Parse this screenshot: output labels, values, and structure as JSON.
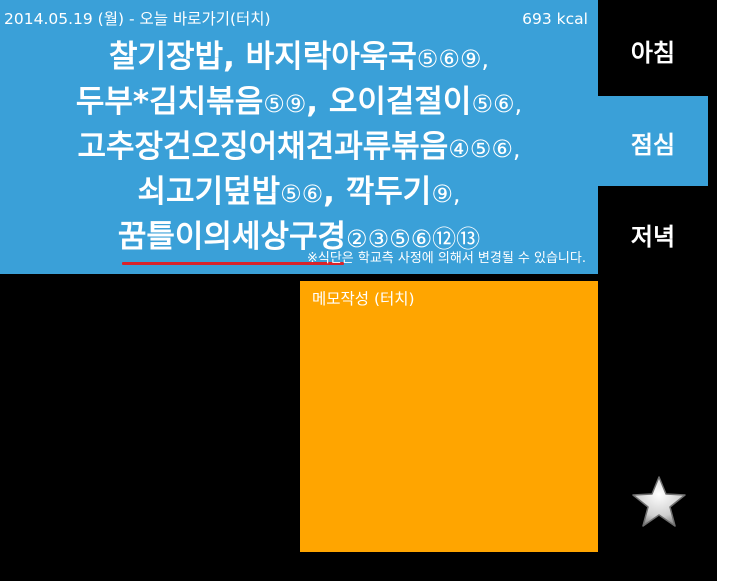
{
  "header": {
    "date_text": "2014.05.19 (월) - 오늘 바로가기(터치)",
    "kcal": "693 kcal"
  },
  "menu": {
    "lines": [
      {
        "text": "찰기장밥, 바지락아욱국",
        "nums": "⑤⑥⑨,"
      },
      {
        "text": "두부*김치볶음",
        "nums": "⑤⑨",
        "text2": ", 오이겉절이",
        "nums2": "⑤⑥,"
      },
      {
        "text": "고추장건오징어채견과류볶음",
        "nums": "④⑤⑥,"
      },
      {
        "text": "쇠고기덮밥",
        "nums": "⑤⑥",
        "text2": ", 깍두기",
        "nums2": "⑨,"
      },
      {
        "text": "꿈틀이의세상구경",
        "nums": "②③⑤⑥⑫⑬"
      }
    ],
    "notice": "※식단은 학교측 사정에 의해서 변경될 수 있습니다."
  },
  "meal_tabs": {
    "breakfast": "아침",
    "lunch": "점심",
    "dinner": "저녁"
  },
  "memo": {
    "label": "메모작성 (터치)"
  },
  "icons": {
    "favorite": "star-icon"
  },
  "colors": {
    "panel_blue": "#3aa0d8",
    "memo_orange": "#ffa500",
    "underline_red": "#d8232a",
    "background": "#000000"
  }
}
